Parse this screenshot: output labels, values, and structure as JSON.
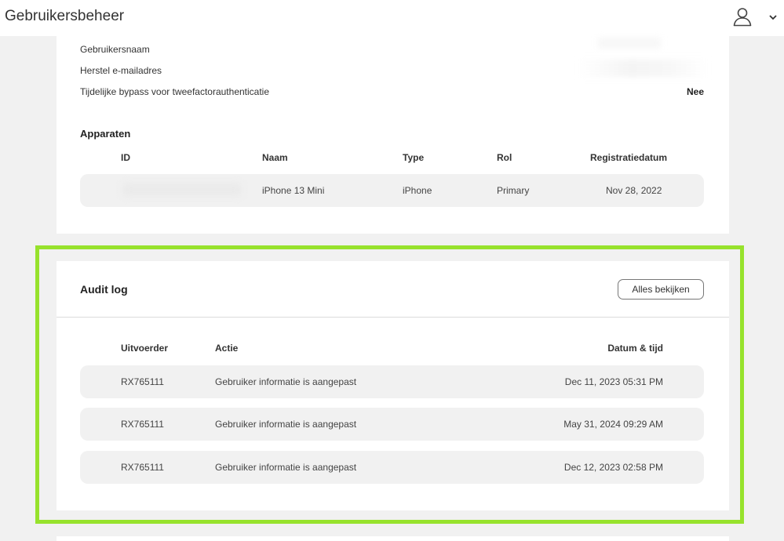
{
  "header": {
    "title": "Gebruikersbeheer",
    "user_icon": "user-icon",
    "menu_icon": "chevron-down-icon"
  },
  "user_info": {
    "username_label": "Gebruikersnaam",
    "recovery_email_label": "Herstel e-mailadres",
    "twofa_bypass_label": "Tijdelijke bypass voor tweefactorauthenticatie",
    "twofa_bypass_value": "Nee"
  },
  "devices": {
    "title": "Apparaten",
    "columns": [
      "ID",
      "Naam",
      "Type",
      "Rol",
      "Registratiedatum"
    ],
    "rows": [
      {
        "id": "",
        "name": "iPhone 13 Mini",
        "type": "iPhone",
        "role": "Primary",
        "registered": "Nov 28, 2022"
      }
    ]
  },
  "audit_log": {
    "title": "Audit log",
    "view_all_label": "Alles bekijken",
    "columns": [
      "Uitvoerder",
      "Actie",
      "Datum & tijd"
    ],
    "rows": [
      {
        "actor": "RX765111",
        "action": "Gebruiker informatie is aangepast",
        "datetime": "Dec 11, 2023 05:31 PM"
      },
      {
        "actor": "RX765111",
        "action": "Gebruiker informatie is aangepast",
        "datetime": "May 31, 2024 09:29 AM"
      },
      {
        "actor": "RX765111",
        "action": "Gebruiker informatie is aangepast",
        "datetime": "Dec 12, 2023 02:58 PM"
      }
    ]
  },
  "colors": {
    "highlight": "#97e22c",
    "row_background": "#f1f1f1",
    "page_background": "#f1f1f1"
  }
}
